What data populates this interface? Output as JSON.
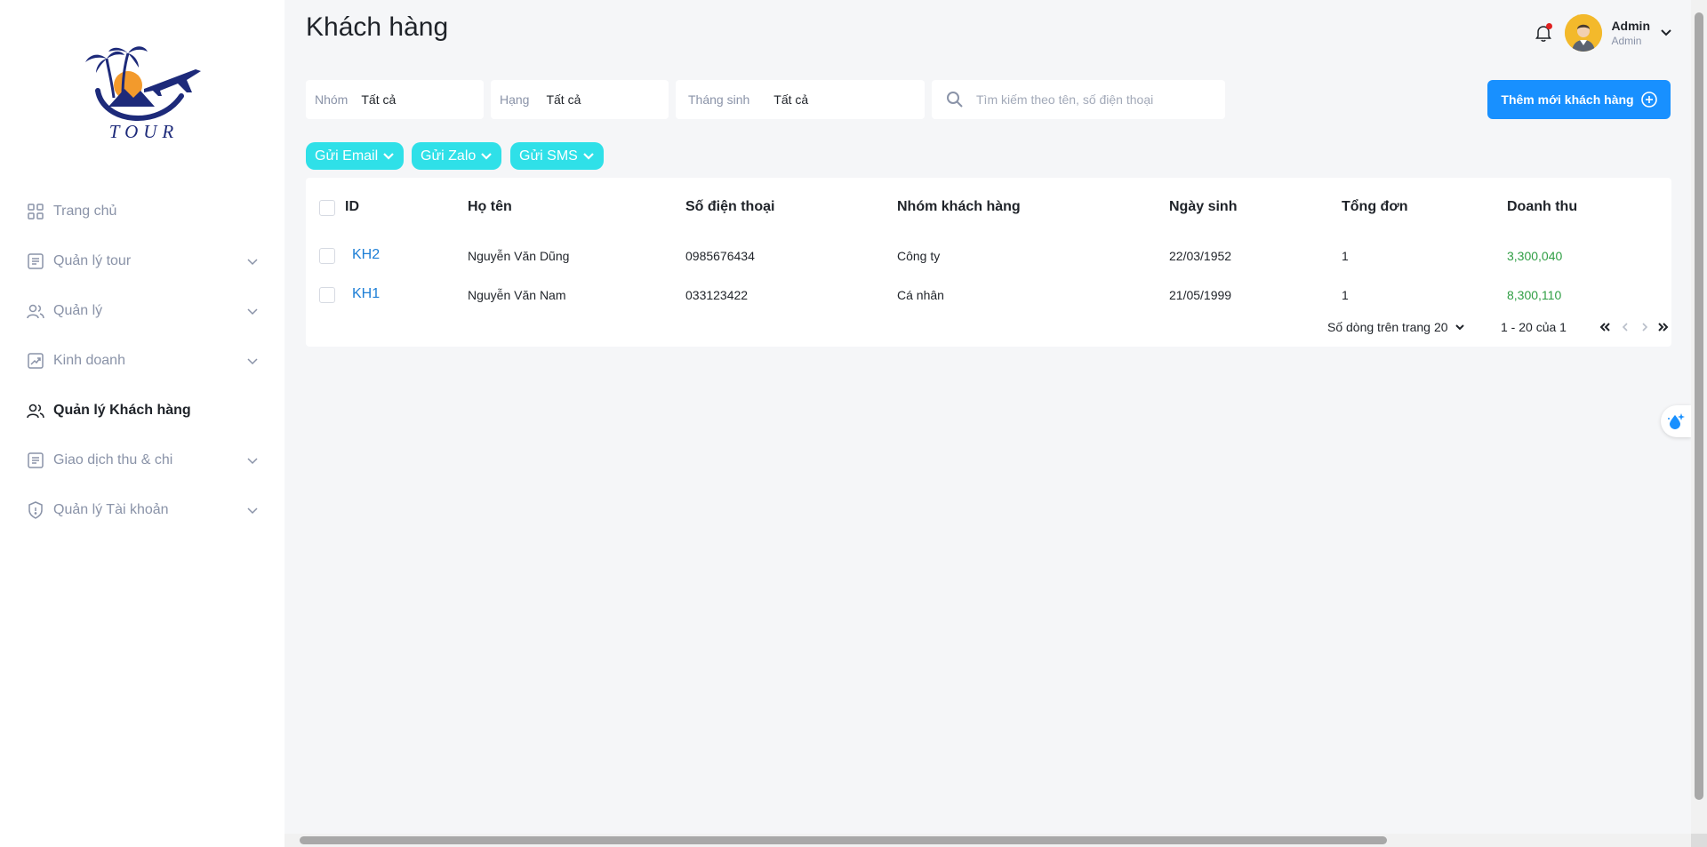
{
  "brand": {
    "logo_text": "TOUR"
  },
  "sidebar": {
    "items": [
      {
        "label": "Trang chủ",
        "icon": "dashboard-icon",
        "has_chevron": false
      },
      {
        "label": "Quản lý tour",
        "icon": "list-icon",
        "has_chevron": true
      },
      {
        "label": "Quản lý",
        "icon": "users-icon",
        "has_chevron": true
      },
      {
        "label": "Kinh doanh",
        "icon": "chart-icon",
        "has_chevron": true
      },
      {
        "label": "Quản lý Khách hàng",
        "icon": "users-icon",
        "has_chevron": false,
        "active": true
      },
      {
        "label": "Giao dịch thu & chi",
        "icon": "list-icon",
        "has_chevron": true
      },
      {
        "label": "Quản lý Tài khoản",
        "icon": "shield-icon",
        "has_chevron": true
      }
    ]
  },
  "header": {
    "title": "Khách hàng",
    "user": {
      "name": "Admin",
      "role": "Admin"
    }
  },
  "filters": {
    "group": {
      "label": "Nhóm",
      "value": "Tất cả"
    },
    "rank": {
      "label": "Hạng",
      "value": "Tất cả"
    },
    "birth_month": {
      "label": "Tháng sinh",
      "value": "Tất cả"
    },
    "search": {
      "placeholder": "Tìm kiếm theo tên, số điện thoại",
      "value": ""
    }
  },
  "actions": {
    "add_customer": "Thêm mới khách hàng",
    "send_email": "Gửi Email",
    "send_zalo": "Gửi Zalo",
    "send_sms": "Gửi SMS"
  },
  "table": {
    "columns": [
      "ID",
      "Họ tên",
      "Số điện thoại",
      "Nhóm khách hàng",
      "Ngày sinh",
      "Tổng đơn",
      "Doanh thu"
    ],
    "rows": [
      {
        "id": "KH2",
        "name": "Nguyễn Văn Dũng",
        "phone": "0985676434",
        "group": "Công ty",
        "birthday": "22/03/1952",
        "orders": "1",
        "revenue": "3,300,040"
      },
      {
        "id": "KH1",
        "name": "Nguyễn Văn Nam",
        "phone": "033123422",
        "group": "Cá nhân",
        "birthday": "21/05/1999",
        "orders": "1",
        "revenue": "8,300,110"
      }
    ]
  },
  "pagination": {
    "rows_per_page_label": "Số dòng trên trang",
    "rows_per_page": "20",
    "range": "1 - 20 của 1"
  },
  "colors": {
    "primary": "#1890ff",
    "pill": "#2fe0e8",
    "link": "#1c7ed6",
    "revenue": "#2f9e44",
    "notification_dot": "#e02020"
  }
}
